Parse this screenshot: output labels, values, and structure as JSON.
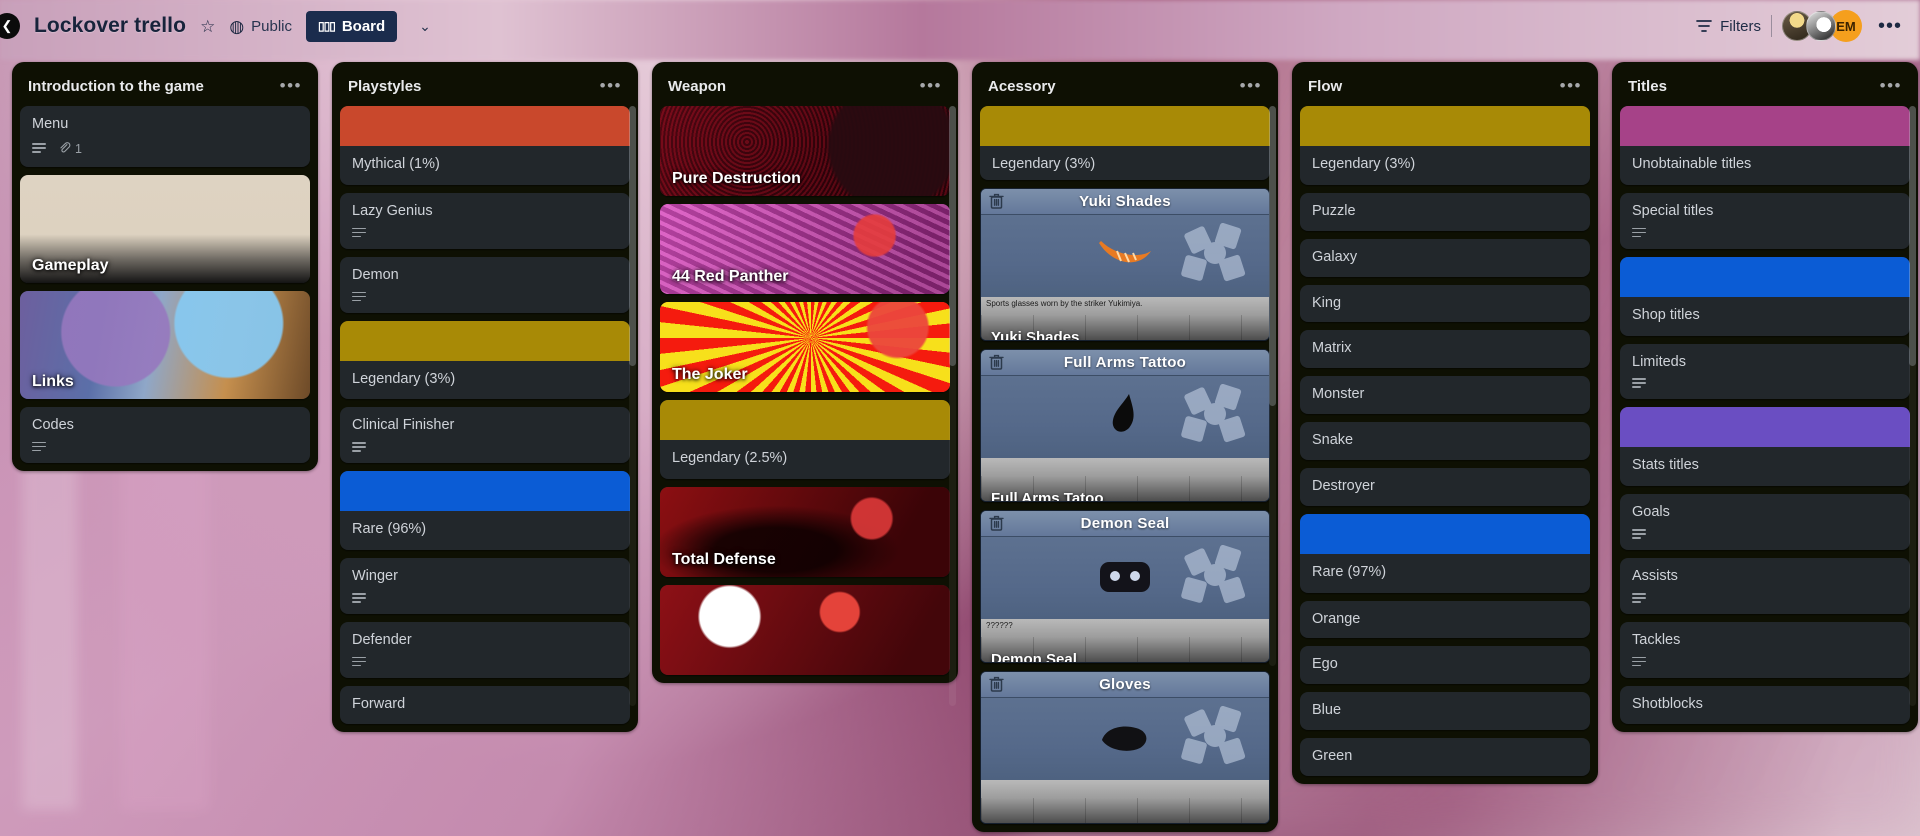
{
  "topbar": {
    "back_icon": "chevron-left-icon",
    "board_title": "Lockover trello",
    "star_icon": "☆",
    "globe_icon": "◍",
    "visibility": "Public",
    "board_button": "Board",
    "board_button_icon": "board-icon",
    "chevron": "⌄",
    "filters_icon": "filter-icon",
    "filters_label": "Filters",
    "avatar_initials": "EM",
    "more_dots": "•••"
  },
  "lists": [
    {
      "title": "Introduction to the game",
      "menu": "•••",
      "cards": [
        {
          "type": "plain",
          "title": "Menu",
          "desc_badge": true,
          "attachment_count": "1"
        },
        {
          "type": "art",
          "title": "Gameplay",
          "art": "gp-art"
        },
        {
          "type": "art",
          "title": "Links",
          "art": "links-art"
        },
        {
          "type": "plain",
          "title": "Codes",
          "desc_badge": true
        }
      ]
    },
    {
      "title": "Playstyles",
      "menu": "•••",
      "cards": [
        {
          "type": "label",
          "title": "Mythical (1%)",
          "color": "#c9482c"
        },
        {
          "type": "plain",
          "title": "Lazy Genius",
          "desc_badge": true
        },
        {
          "type": "plain",
          "title": "Demon",
          "desc_badge": true
        },
        {
          "type": "label",
          "title": "Legendary (3%)",
          "color": "#a88a06"
        },
        {
          "type": "plain",
          "title": "Clinical Finisher",
          "desc_badge": true
        },
        {
          "type": "label",
          "title": "Rare (96%)",
          "color": "#0b5cd5"
        },
        {
          "type": "plain",
          "title": "Winger",
          "desc_badge": true
        },
        {
          "type": "plain",
          "title": "Defender",
          "desc_badge": true
        },
        {
          "type": "plain",
          "title": "Forward",
          "desc_badge": false
        }
      ]
    },
    {
      "title": "Weapon",
      "menu": "•••",
      "cards": [
        {
          "type": "weapon",
          "title": "Pure Destruction",
          "art": "pd-art"
        },
        {
          "type": "weapon",
          "title": "44 Red Panther",
          "art": "rp-art"
        },
        {
          "type": "weapon",
          "title": "The Joker",
          "art": "jk-art"
        },
        {
          "type": "label",
          "title": "Legendary (2.5%)",
          "color": "#a88a06"
        },
        {
          "type": "weapon",
          "title": "Total Defense",
          "art": "td-art"
        },
        {
          "type": "weapon",
          "title": "",
          "art": "ft-art"
        }
      ]
    },
    {
      "title": "Acessory",
      "menu": "•••",
      "cards": [
        {
          "type": "label",
          "title": "Legendary (3%)",
          "color": "#a88a06"
        },
        {
          "type": "gear",
          "header": "Yuki Shades",
          "desc": "Sports glasses worn by the striker Yukimiya.",
          "footer": "Yuki Shades",
          "item": "shades"
        },
        {
          "type": "gear",
          "header": "Full Arms Tattoo",
          "desc": "",
          "footer": "Full Arms Tatoo",
          "item": "tattoo"
        },
        {
          "type": "gear",
          "header": "Demon Seal",
          "desc": "??????",
          "footer": "Demon Seal",
          "item": "seal"
        },
        {
          "type": "gear",
          "header": "Gloves",
          "desc": "",
          "footer": "",
          "item": "glove"
        }
      ]
    },
    {
      "title": "Flow",
      "menu": "•••",
      "cards": [
        {
          "type": "label",
          "title": "Legendary (3%)",
          "color": "#a88a06"
        },
        {
          "type": "plain",
          "title": "Puzzle"
        },
        {
          "type": "plain",
          "title": "Galaxy"
        },
        {
          "type": "plain",
          "title": "King"
        },
        {
          "type": "plain",
          "title": "Matrix"
        },
        {
          "type": "plain",
          "title": "Monster"
        },
        {
          "type": "plain",
          "title": "Snake"
        },
        {
          "type": "plain",
          "title": "Destroyer"
        },
        {
          "type": "label",
          "title": "Rare (97%)",
          "color": "#0b5cd5"
        },
        {
          "type": "plain",
          "title": "Orange"
        },
        {
          "type": "plain",
          "title": "Ego"
        },
        {
          "type": "plain",
          "title": "Blue"
        },
        {
          "type": "plain",
          "title": "Green"
        }
      ]
    },
    {
      "title": "Titles",
      "menu": "•••",
      "cards": [
        {
          "type": "label",
          "title": "Unobtainable titles",
          "color": "#a64288"
        },
        {
          "type": "plain",
          "title": "Special titles",
          "desc_badge": true
        },
        {
          "type": "label",
          "title": "Shop titles",
          "color": "#0b5cd5"
        },
        {
          "type": "plain",
          "title": "Limiteds",
          "desc_badge": true
        },
        {
          "type": "label",
          "title": "Stats titles",
          "color": "#6a4ec2"
        },
        {
          "type": "plain",
          "title": "Goals",
          "desc_badge": true
        },
        {
          "type": "plain",
          "title": "Assists",
          "desc_badge": true
        },
        {
          "type": "plain",
          "title": "Tackles",
          "desc_badge": true
        },
        {
          "type": "plain",
          "title": "Shotblocks",
          "desc_badge": false
        }
      ]
    }
  ]
}
